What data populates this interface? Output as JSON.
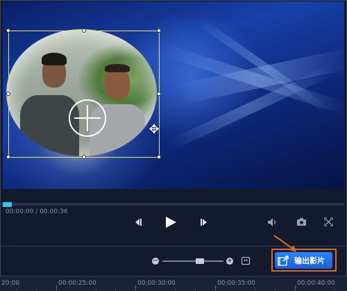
{
  "player": {
    "current_time": "00:00:00",
    "separator": " / ",
    "total_time": "00:00:36",
    "progress_fraction": 0.0
  },
  "controls": {
    "prev_frame_icon": "step-back-icon",
    "play_icon": "play-icon",
    "next_frame_icon": "step-forward-icon",
    "volume_icon": "volume-icon",
    "snapshot_icon": "camera-icon",
    "fullscreen_icon": "fullscreen-icon"
  },
  "zoom": {
    "minus_label": "−",
    "plus_label": "+",
    "level_fraction": 0.6
  },
  "export": {
    "label": "输出影片",
    "highlight_color": "#e06a1d",
    "button_color": "#2a84ff"
  },
  "timeline": {
    "labels": [
      "20:00",
      "00:00:25:00",
      "00:00:30:00",
      "00:00:35:00",
      "00:00:40:00"
    ]
  },
  "colors": {
    "accent": "#2ec4f0",
    "selection": "#e6e86a"
  }
}
